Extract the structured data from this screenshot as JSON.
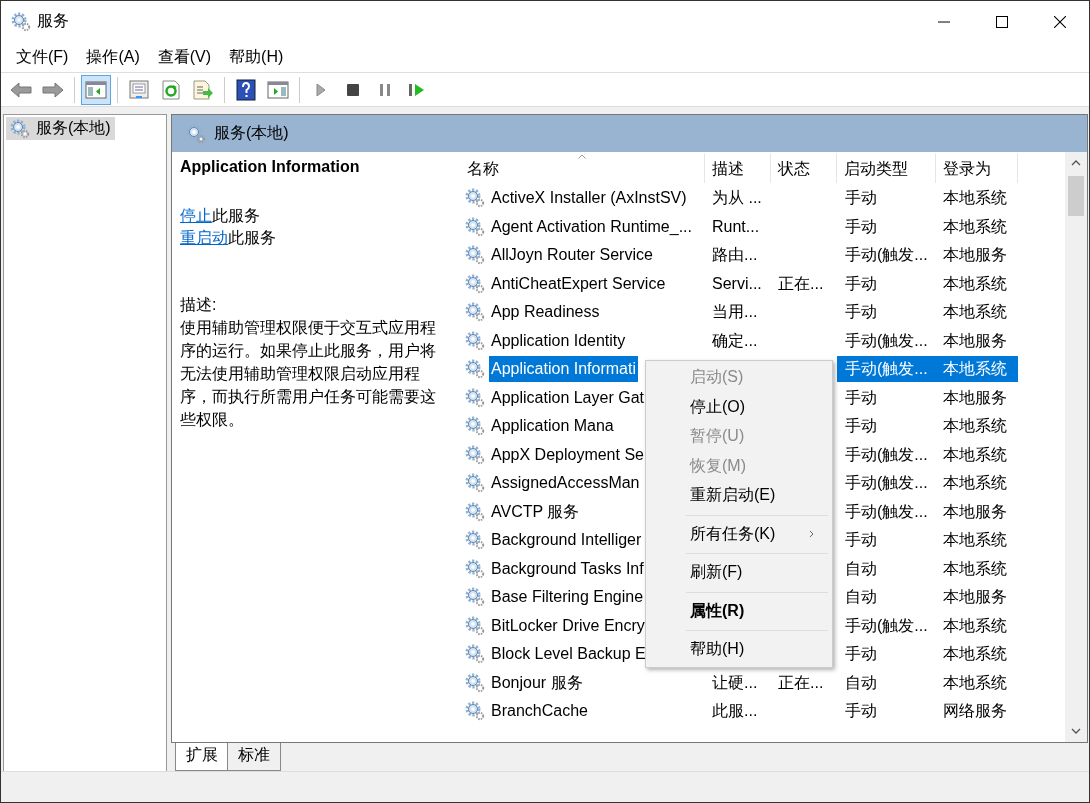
{
  "window": {
    "title": "服务"
  },
  "menu_bar": [
    "文件(F)",
    "操作(A)",
    "查看(V)",
    "帮助(H)"
  ],
  "toolbar": [
    {
      "kind": "back",
      "selected": false
    },
    {
      "kind": "forward",
      "selected": false
    },
    {
      "kind": "separator"
    },
    {
      "kind": "console-tree",
      "selected": true
    },
    {
      "kind": "separator"
    },
    {
      "kind": "properties",
      "selected": false
    },
    {
      "kind": "refresh",
      "selected": false
    },
    {
      "kind": "export",
      "selected": false
    },
    {
      "kind": "separator"
    },
    {
      "kind": "help",
      "selected": false
    },
    {
      "kind": "action-pane",
      "selected": false
    },
    {
      "kind": "separator"
    },
    {
      "kind": "start",
      "selected": false
    },
    {
      "kind": "stop",
      "selected": false
    },
    {
      "kind": "pause",
      "selected": false
    },
    {
      "kind": "resume",
      "selected": false
    }
  ],
  "tree": {
    "items": [
      {
        "label": "服务(本地)",
        "selected": true
      }
    ]
  },
  "panel": {
    "title": "服务(本地)"
  },
  "details": {
    "service_name": "Application Information",
    "actions": [
      {
        "link": "停止",
        "text": "此服务"
      },
      {
        "link": "重启动",
        "text": "此服务"
      }
    ],
    "description_label": "描述:",
    "description": "使用辅助管理权限便于交互式应用程序的运行。如果停止此服务，用户将无法使用辅助管理权限启动应用程序，而执行所需用户任务可能需要这些权限。"
  },
  "table": {
    "columns": [
      {
        "label": "名称",
        "sorted": true
      },
      {
        "label": "描述",
        "sorted": false
      },
      {
        "label": "状态",
        "sorted": false
      },
      {
        "label": "启动类型",
        "sorted": false
      },
      {
        "label": "登录为",
        "sorted": false
      }
    ],
    "rows": [
      {
        "name": "ActiveX Installer (AxInstSV)",
        "description": "为从 ...",
        "startup_type": "手动",
        "log_on_as": "本地系统",
        "selected": false
      },
      {
        "name": "Agent Activation Runtime_...",
        "description": "Runt...",
        "startup_type": "手动",
        "log_on_as": "本地系统",
        "selected": false
      },
      {
        "name": "AllJoyn Router Service",
        "description": "路由...",
        "startup_type": "手动(触发...",
        "log_on_as": "本地服务",
        "selected": false
      },
      {
        "name": "AntiCheatExpert Service",
        "description": "Servi...",
        "status": "正在...",
        "startup_type": "手动",
        "log_on_as": "本地系统",
        "selected": false
      },
      {
        "name": "App Readiness",
        "description": "当用...",
        "startup_type": "手动",
        "log_on_as": "本地系统",
        "selected": false
      },
      {
        "name": "Application Identity",
        "description": "确定...",
        "startup_type": "手动(触发...",
        "log_on_as": "本地服务",
        "selected": false
      },
      {
        "name": "Application Informati",
        "startup_type": "手动(触发...",
        "log_on_as": "本地系统",
        "selected": true
      },
      {
        "name": "Application Layer Gat",
        "startup_type": "手动",
        "log_on_as": "本地服务",
        "selected": false
      },
      {
        "name": "Application Mana",
        "startup_type": "手动",
        "log_on_as": "本地系统",
        "selected": false
      },
      {
        "name": "AppX Deployment Se",
        "startup_type": "手动(触发...",
        "log_on_as": "本地系统",
        "selected": false
      },
      {
        "name": "AssignedAccessMan",
        "startup_type": "手动(触发...",
        "log_on_as": "本地系统",
        "selected": false
      },
      {
        "name": "AVCTP 服务",
        "startup_type": "手动(触发...",
        "log_on_as": "本地服务",
        "selected": false
      },
      {
        "name": "Background Intelliger",
        "startup_type": "手动",
        "log_on_as": "本地系统",
        "selected": false
      },
      {
        "name": "Background Tasks Inf",
        "startup_type": "自动",
        "log_on_as": "本地系统",
        "selected": false
      },
      {
        "name": "Base Filtering Engine",
        "startup_type": "自动",
        "log_on_as": "本地服务",
        "selected": false
      },
      {
        "name": "BitLocker Drive Encry",
        "startup_type": "手动(触发...",
        "log_on_as": "本地系统",
        "selected": false
      },
      {
        "name": "Block Level Backup E",
        "startup_type": "手动",
        "log_on_as": "本地系统",
        "selected": false
      },
      {
        "name": "Bonjour 服务",
        "description": "让硬...",
        "status": "正在...",
        "startup_type": "自动",
        "log_on_as": "本地系统",
        "selected": false
      },
      {
        "name": "BranchCache",
        "description": "此服...",
        "startup_type": "手动",
        "log_on_as": "网络服务",
        "selected": false
      }
    ]
  },
  "context_menu": {
    "items": [
      {
        "kind": "item",
        "label": "启动(S)",
        "disabled": true,
        "default": false
      },
      {
        "kind": "item",
        "label": "停止(O)",
        "disabled": false,
        "default": false
      },
      {
        "kind": "item",
        "label": "暂停(U)",
        "disabled": true,
        "default": false
      },
      {
        "kind": "item",
        "label": "恢复(M)",
        "disabled": true,
        "default": false
      },
      {
        "kind": "item",
        "label": "重新启动(E)",
        "disabled": false,
        "default": false
      },
      {
        "kind": "separator"
      },
      {
        "kind": "submenu",
        "label": "所有任务(K)",
        "disabled": false,
        "default": false
      },
      {
        "kind": "separator"
      },
      {
        "kind": "item",
        "label": "刷新(F)",
        "disabled": false,
        "default": false
      },
      {
        "kind": "separator"
      },
      {
        "kind": "item",
        "label": "属性(R)",
        "disabled": false,
        "default": true
      },
      {
        "kind": "separator"
      },
      {
        "kind": "item",
        "label": "帮助(H)",
        "disabled": false,
        "default": false
      }
    ]
  },
  "tabs": [
    {
      "label": "扩展",
      "selected": true
    },
    {
      "label": "标准",
      "selected": false
    }
  ]
}
